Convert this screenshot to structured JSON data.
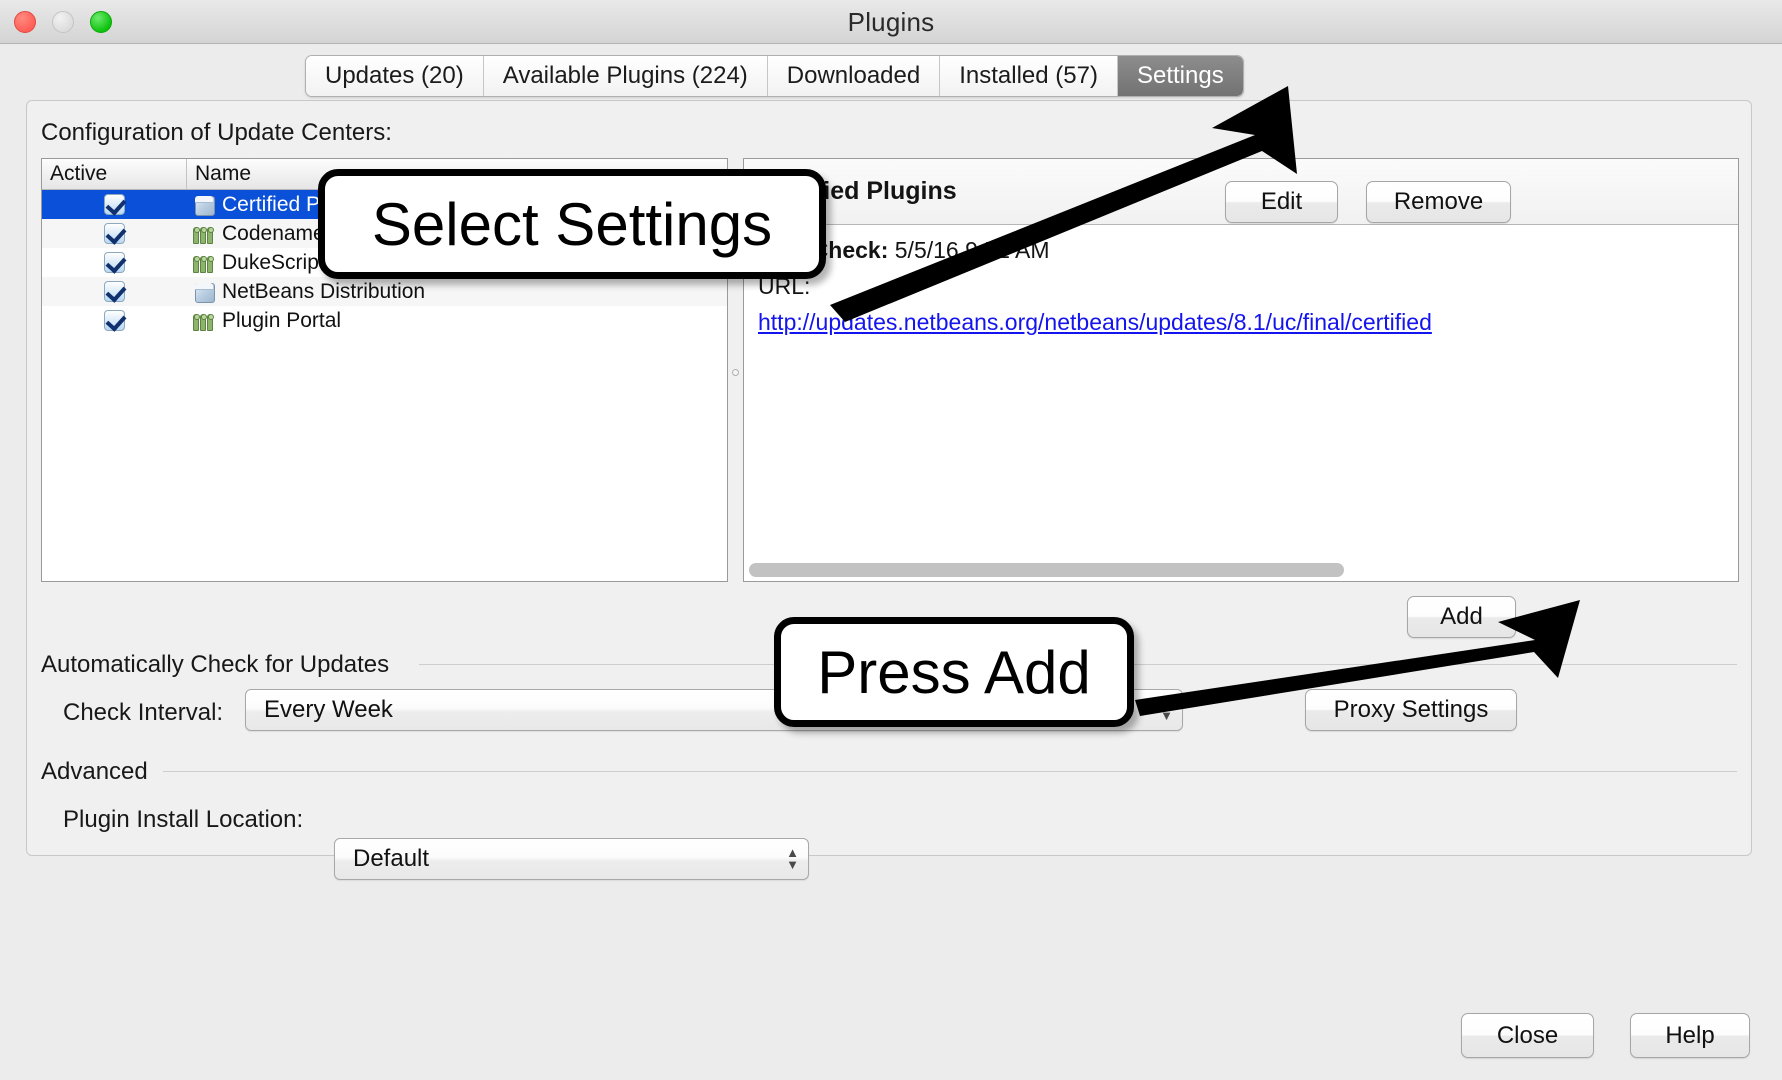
{
  "window": {
    "title": "Plugins",
    "controls": {
      "close": "close",
      "minimize": "minimize",
      "zoom": "zoom"
    }
  },
  "tabs": [
    {
      "label": "Updates (20)",
      "active": false
    },
    {
      "label": "Available Plugins (224)",
      "active": false
    },
    {
      "label": "Downloaded",
      "active": false
    },
    {
      "label": "Installed (57)",
      "active": false
    },
    {
      "label": "Settings",
      "active": true
    }
  ],
  "settings": {
    "config_label": "Configuration of Update Centers:",
    "table": {
      "columns": [
        "Active",
        "Name"
      ],
      "rows": [
        {
          "active": true,
          "name": "Certified Plugins",
          "icon": "cube-icon",
          "selected": true
        },
        {
          "active": true,
          "name": "Codename One",
          "icon": "people-icon",
          "selected": false
        },
        {
          "active": true,
          "name": "DukeScript",
          "icon": "people-icon",
          "selected": false
        },
        {
          "active": true,
          "name": "NetBeans Distribution",
          "icon": "cube-icon",
          "selected": false
        },
        {
          "active": true,
          "name": "Plugin Portal",
          "icon": "people-icon",
          "selected": false
        }
      ]
    },
    "detail": {
      "title": "Certified Plugins",
      "last_check_label": "Last Check:",
      "last_check_value": "5/5/16 9:51 AM",
      "url_label": "URL:",
      "url_value": "http://updates.netbeans.org/netbeans/updates/8.1/uc/final/certified"
    },
    "buttons": {
      "edit": "Edit",
      "remove": "Remove",
      "add": "Add",
      "proxy": "Proxy Settings"
    },
    "auto_check": {
      "group_label": "Automatically Check for Updates",
      "interval_label": "Check Interval:",
      "interval_value": "Every Week"
    },
    "advanced": {
      "group_label": "Advanced",
      "install_label": "Plugin Install Location:",
      "install_value": "Default"
    }
  },
  "footer": {
    "close": "Close",
    "help": "Help"
  },
  "annotations": [
    {
      "text": "Select Settings",
      "target": "settings-tab"
    },
    {
      "text": "Press Add",
      "target": "add-button"
    }
  ]
}
